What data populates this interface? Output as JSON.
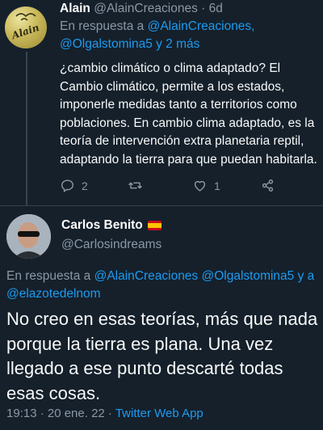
{
  "tweet1": {
    "name": "Alain",
    "handle": "@AlainCreaciones",
    "time": "· 6d",
    "reply_prefix": "En respuesta a ",
    "reply_mentions": "@AlainCreaciones, @Olgalstomina5 y 2 más",
    "text": "¿cambio climático o clima adaptado? El Cambio climático, permite a los estados, imponerle medidas tanto a territorios como poblaciones. En cambio clima adaptado, es la teoría de intervención extra planetaria reptil, adaptando la tierra para que puedan habitarla.",
    "avatar_text": "Alain",
    "replies": "2",
    "likes": "1"
  },
  "tweet2": {
    "name": "Carlos Benito",
    "handle": "@Carlosindreams",
    "reply_prefix": "En respuesta a ",
    "reply_mentions": "@AlainCreaciones @Olgalstomina5 y a @elazotedelnom",
    "text": "No creo en esas teorías, más que nada porque la tierra es plana. Una vez llegado a ese punto descarté todas esas cosas.",
    "timestamp": "19:13 · 20 ene. 22 · ",
    "source": "Twitter Web App"
  },
  "colors": {
    "background": "#15202b",
    "link": "#1d9bf0",
    "muted": "#8b98a5"
  }
}
